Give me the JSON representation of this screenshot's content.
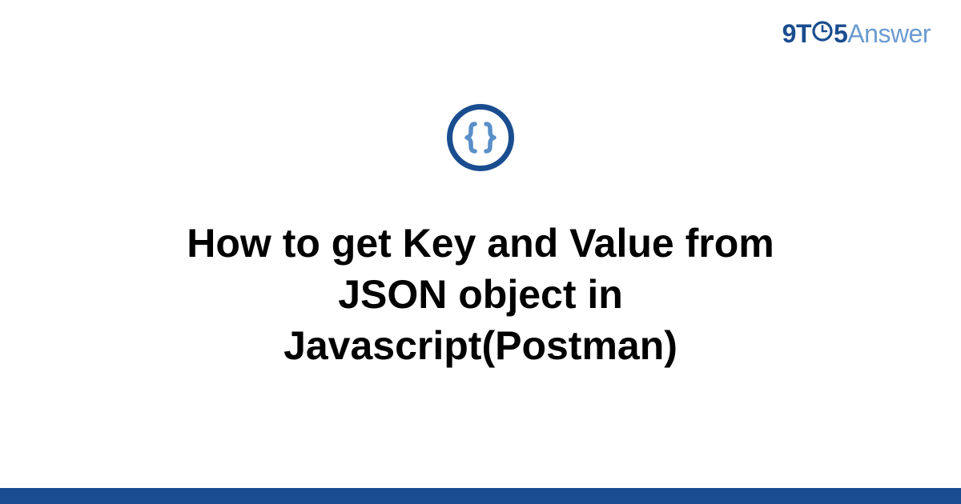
{
  "brand": {
    "nine": "9",
    "t": "T",
    "five": "5",
    "answer": "Answer"
  },
  "icon": {
    "name": "json-braces"
  },
  "headline": "How to get Key and Value from JSON object in Javascript(Postman)",
  "colors": {
    "brand_primary": "#1a4d8f",
    "brand_secondary": "#6b9bd1",
    "icon_brace": "#5a8fc7"
  }
}
